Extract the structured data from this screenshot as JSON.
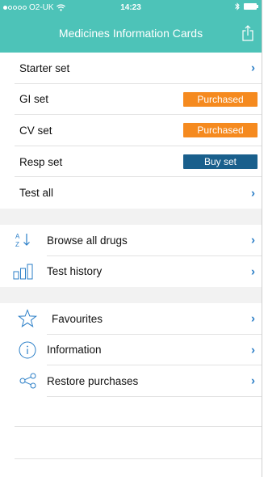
{
  "status_bar": {
    "carrier": "O2-UK",
    "time": "14:23"
  },
  "nav": {
    "title": "Medicines Information Cards"
  },
  "sets": [
    {
      "label": "Starter set",
      "action": "chevron"
    },
    {
      "label": "GI set",
      "action": "button",
      "button_label": "Purchased",
      "button_color": "#f58a1f"
    },
    {
      "label": "CV set",
      "action": "button",
      "button_label": "Purchased",
      "button_color": "#f58a1f"
    },
    {
      "label": "Resp set",
      "action": "button",
      "button_label": "Buy set",
      "button_color": "#195f8c"
    },
    {
      "label": "Test all",
      "action": "chevron"
    }
  ],
  "tools": [
    {
      "label": "Browse all drugs",
      "icon": "sort-az-icon"
    },
    {
      "label": "Test history",
      "icon": "bar-chart-icon"
    }
  ],
  "more": [
    {
      "label": "Favourites",
      "icon": "star-icon"
    },
    {
      "label": "Information",
      "icon": "info-icon"
    },
    {
      "label": "Restore purchases",
      "icon": "share-nodes-icon"
    }
  ],
  "colors": {
    "nav_bg": "#4dc3b8",
    "chevron": "#2a7ec7",
    "purchased": "#f58a1f",
    "buy": "#195f8c"
  }
}
